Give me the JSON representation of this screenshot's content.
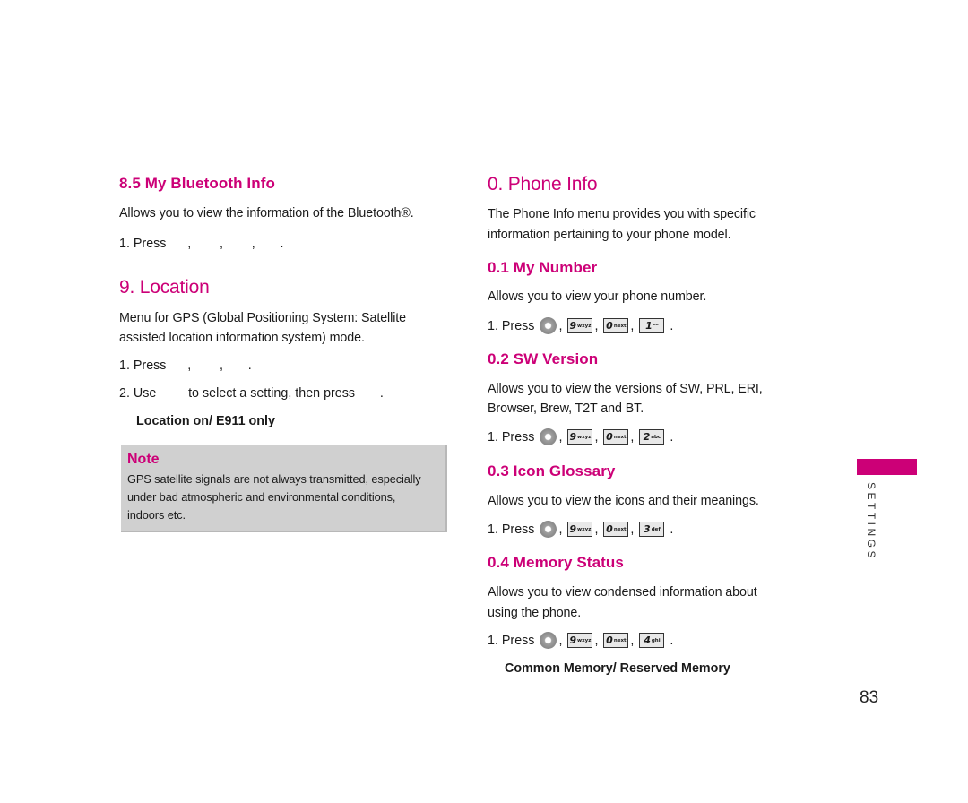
{
  "left": {
    "bluetooth": {
      "heading": "8.5 My Bluetooth Info",
      "description": "Allows you to view the information of the Bluetooth®.",
      "step1": "1. Press      ,        ,        ,       ."
    },
    "location": {
      "heading": "9. Location",
      "description_line1": "Menu for GPS (Global Positioning System: Satellite",
      "description_line2": "assisted location information system) mode.",
      "step1": "1. Press      ,        ,       .",
      "step2": "2. Use         to select a setting, then press       .",
      "options": "Location on/ E911  only"
    },
    "note": {
      "title": "Note",
      "line1": "GPS satellite signals are not always transmitted, especially",
      "line2": "under bad atmospheric and environmental conditions,",
      "line3": "indoors etc."
    }
  },
  "right": {
    "phone_info": {
      "heading": "0. Phone Info",
      "description_line1": "The Phone Info menu provides you with specific",
      "description_line2": "information pertaining to your phone model."
    },
    "sections": [
      {
        "heading": "0.1 My Number",
        "description": [
          "Allows you to view your phone number."
        ],
        "press_label": "1. Press",
        "keys": [
          {
            "digit": "9",
            "letters": "wxyz"
          },
          {
            "digit": "0",
            "letters": "next"
          },
          {
            "digit": "1",
            "letters": "ᴼᴼ"
          }
        ]
      },
      {
        "heading": "0.2 SW Version",
        "description": [
          "Allows you to view the versions of SW, PRL, ERI,",
          "Browser, Brew, T2T and BT."
        ],
        "press_label": "1. Press",
        "keys": [
          {
            "digit": "9",
            "letters": "wxyz"
          },
          {
            "digit": "0",
            "letters": "next"
          },
          {
            "digit": "2",
            "letters": "abc"
          }
        ]
      },
      {
        "heading": "0.3 Icon Glossary",
        "description": [
          "Allows you to view the icons and their meanings."
        ],
        "press_label": "1. Press",
        "keys": [
          {
            "digit": "9",
            "letters": "wxyz"
          },
          {
            "digit": "0",
            "letters": "next"
          },
          {
            "digit": "3",
            "letters": "def"
          }
        ]
      },
      {
        "heading": "0.4 Memory Status",
        "description": [
          "Allows you to view condensed information about",
          "using the phone."
        ],
        "press_label": "1. Press",
        "keys": [
          {
            "digit": "9",
            "letters": "wxyz"
          },
          {
            "digit": "0",
            "letters": "next"
          },
          {
            "digit": "4",
            "letters": "ghi"
          }
        ],
        "options": "Common Memory/ Reserved Memory"
      }
    ]
  },
  "sidebar": {
    "section_label": "SETTINGS",
    "page_number": "83"
  },
  "colors": {
    "accent": "#cc0077",
    "note_background": "#d0d0d0"
  }
}
